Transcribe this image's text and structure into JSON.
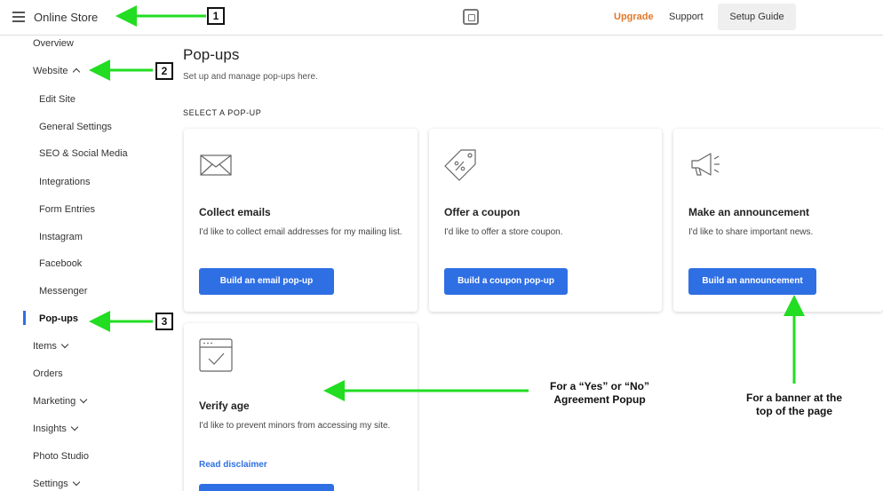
{
  "topbar": {
    "app_title": "Online Store",
    "upgrade": "Upgrade",
    "support": "Support",
    "setup_guide": "Setup Guide"
  },
  "sidebar": {
    "items": [
      {
        "label": "Overview"
      },
      {
        "label": "Website",
        "expanded": true
      },
      {
        "label": "Edit Site"
      },
      {
        "label": "General Settings"
      },
      {
        "label": "SEO & Social Media"
      },
      {
        "label": "Integrations"
      },
      {
        "label": "Form Entries"
      },
      {
        "label": "Instagram"
      },
      {
        "label": "Facebook"
      },
      {
        "label": "Messenger"
      },
      {
        "label": "Pop-ups",
        "active": true
      },
      {
        "label": "Items"
      },
      {
        "label": "Orders"
      },
      {
        "label": "Marketing"
      },
      {
        "label": "Insights"
      },
      {
        "label": "Photo Studio"
      },
      {
        "label": "Settings"
      }
    ]
  },
  "main": {
    "title": "Pop-ups",
    "subtitle": "Set up and manage pop-ups here.",
    "section_label": "SELECT A POP-UP",
    "cards": [
      {
        "icon": "envelope-icon",
        "title": "Collect emails",
        "desc": "I'd like to collect email addresses for my mailing list.",
        "button": "Build an email pop-up"
      },
      {
        "icon": "coupon-tag-icon",
        "title": "Offer a coupon",
        "desc": "I'd like to offer a store coupon.",
        "button": "Build a coupon pop-up"
      },
      {
        "icon": "megaphone-icon",
        "title": "Make an announcement",
        "desc": "I'd like to share important news.",
        "button": "Build an announcement"
      },
      {
        "icon": "browser-check-icon",
        "title": "Verify age",
        "desc": "I'd like to prevent minors from accessing my site.",
        "link": "Read disclaimer"
      }
    ]
  },
  "annotations": {
    "badges": [
      "1",
      "2",
      "3"
    ],
    "note_agreement_line1": "For a “Yes” or “No”",
    "note_agreement_line2": "Agreement Popup",
    "note_banner_line1": "For a banner at the",
    "note_banner_line2": "top of the page",
    "arrow_color": "#22dd22"
  },
  "colors": {
    "accent": "#2f6fe4",
    "upgrade": "#e0782a"
  }
}
